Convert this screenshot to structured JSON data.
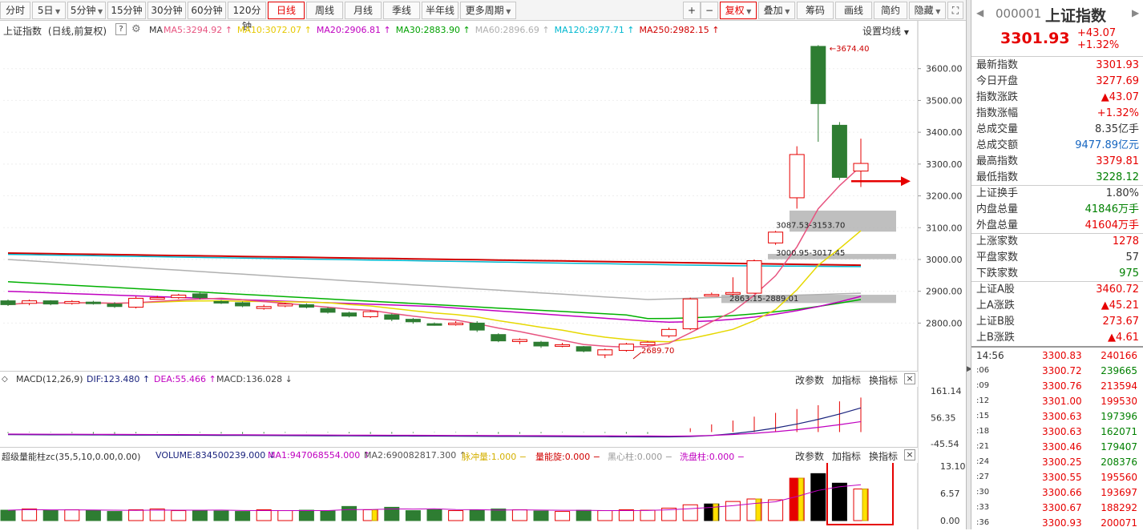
{
  "toolbar": {
    "periods": [
      {
        "label": "分时",
        "dd": false
      },
      {
        "label": "5日",
        "dd": true
      },
      {
        "label": "5分钟",
        "dd": true
      },
      {
        "label": "15分钟",
        "dd": false
      },
      {
        "label": "30分钟",
        "dd": false
      },
      {
        "label": "60分钟",
        "dd": false
      },
      {
        "label": "120分钟",
        "dd": false
      },
      {
        "label": "日线",
        "dd": false
      },
      {
        "label": "周线",
        "dd": false
      },
      {
        "label": "月线",
        "dd": false
      },
      {
        "label": "季线",
        "dd": false
      },
      {
        "label": "半年线",
        "dd": false
      },
      {
        "label": "更多周期",
        "dd": true
      }
    ],
    "active_period": "日线",
    "plus": "+",
    "minus": "−",
    "fuquan": "复权",
    "diejia": "叠加",
    "chouma": "筹码",
    "huaxian": "画线",
    "jianyue": "简约",
    "yincang": "隐藏"
  },
  "header": {
    "title": "上证指数",
    "mode": "(日线,前复权)",
    "help": "?",
    "ma_label": "MA",
    "ma": [
      {
        "name": "MA5",
        "value": "3294.92",
        "color": "#e75480"
      },
      {
        "name": "MA10",
        "value": "3072.07",
        "color": "#e6c800"
      },
      {
        "name": "MA20",
        "value": "2906.81",
        "color": "#c000c0"
      },
      {
        "name": "MA30",
        "value": "2883.90",
        "color": "#00a000"
      },
      {
        "name": "MA60",
        "value": "2896.69",
        "color": "#b0b0b0"
      },
      {
        "name": "MA120",
        "value": "2977.71",
        "color": "#00b8d0"
      },
      {
        "name": "MA250",
        "value": "2982.15",
        "color": "#d00000"
      }
    ],
    "settings": "设置均线"
  },
  "annotations": {
    "high": "3674.40",
    "low": "2689.70",
    "zone1": "3087.53-3153.70",
    "zone2": "3000.95-3017.45",
    "zone3": "2863.15-2889.01"
  },
  "macd": {
    "title": "MACD(12,26,9)",
    "dif_label": "DIF:",
    "dif": "123.480",
    "dea_label": "DEA:",
    "dea": "55.466",
    "macd_label": "MACD:",
    "macd": "136.028",
    "btn_params": "改参数",
    "btn_add": "加指标",
    "btn_switch": "换指标",
    "close": "×"
  },
  "vol": {
    "title": "超级量能柱zc(35,5,10,0.00,0.00)",
    "volume_label": "VOLUME:",
    "volume": "834500239.000",
    "ma1_label": "MA1:",
    "ma1": "947068554.000",
    "ma2_label": "MA2:",
    "ma2": "690082817.300",
    "mcl_label": "脉冲量:",
    "mcl": "1.000",
    "nlx_label": "量能旋:",
    "nlx": "0.000",
    "hxz_label": "黑心柱:",
    "hxz": "0.000",
    "xpz_label": "洗盘柱:",
    "xpz": "0.000",
    "btn_params": "改参数",
    "btn_add": "加指标",
    "btn_switch": "换指标",
    "close": "×"
  },
  "chart_data": [
    {
      "type": "candlestick",
      "title": "上证指数",
      "yticks": [
        "3600.00",
        "3500.00",
        "3400.00",
        "3300.00",
        "3200.00",
        "3100.00",
        "3000.00",
        "2900.00",
        "2800.00"
      ],
      "ylim": [
        2660,
        3700
      ],
      "candles": [
        {
          "o": 2870,
          "c": 2858,
          "h": 2874,
          "l": 2854
        },
        {
          "o": 2862,
          "c": 2870,
          "h": 2874,
          "l": 2856
        },
        {
          "o": 2870,
          "c": 2860,
          "h": 2872,
          "l": 2856
        },
        {
          "o": 2862,
          "c": 2868,
          "h": 2872,
          "l": 2858
        },
        {
          "o": 2866,
          "c": 2862,
          "h": 2870,
          "l": 2858
        },
        {
          "o": 2860,
          "c": 2852,
          "h": 2866,
          "l": 2848
        },
        {
          "o": 2850,
          "c": 2878,
          "h": 2884,
          "l": 2846
        },
        {
          "o": 2878,
          "c": 2880,
          "h": 2886,
          "l": 2874
        },
        {
          "o": 2880,
          "c": 2888,
          "h": 2892,
          "l": 2876
        },
        {
          "o": 2892,
          "c": 2880,
          "h": 2896,
          "l": 2874
        },
        {
          "o": 2868,
          "c": 2864,
          "h": 2872,
          "l": 2860
        },
        {
          "o": 2864,
          "c": 2854,
          "h": 2868,
          "l": 2850
        },
        {
          "o": 2846,
          "c": 2852,
          "h": 2858,
          "l": 2842
        },
        {
          "o": 2854,
          "c": 2860,
          "h": 2864,
          "l": 2850
        },
        {
          "o": 2858,
          "c": 2850,
          "h": 2862,
          "l": 2846
        },
        {
          "o": 2846,
          "c": 2834,
          "h": 2850,
          "l": 2830
        },
        {
          "o": 2832,
          "c": 2822,
          "h": 2836,
          "l": 2818
        },
        {
          "o": 2820,
          "c": 2836,
          "h": 2840,
          "l": 2816
        },
        {
          "o": 2826,
          "c": 2812,
          "h": 2830,
          "l": 2806
        },
        {
          "o": 2812,
          "c": 2804,
          "h": 2816,
          "l": 2798
        },
        {
          "o": 2798,
          "c": 2796,
          "h": 2802,
          "l": 2792
        },
        {
          "o": 2796,
          "c": 2800,
          "h": 2806,
          "l": 2792
        },
        {
          "o": 2800,
          "c": 2778,
          "h": 2806,
          "l": 2772
        },
        {
          "o": 2764,
          "c": 2744,
          "h": 2768,
          "l": 2740
        },
        {
          "o": 2742,
          "c": 2748,
          "h": 2752,
          "l": 2734
        },
        {
          "o": 2740,
          "c": 2728,
          "h": 2744,
          "l": 2722
        },
        {
          "o": 2730,
          "c": 2732,
          "h": 2738,
          "l": 2724
        },
        {
          "o": 2726,
          "c": 2712,
          "h": 2728,
          "l": 2708
        },
        {
          "o": 2700,
          "c": 2716,
          "h": 2720,
          "l": 2690
        },
        {
          "o": 2714,
          "c": 2734,
          "h": 2738,
          "l": 2710
        },
        {
          "o": 2732,
          "c": 2740,
          "h": 2744,
          "l": 2728
        },
        {
          "o": 2760,
          "c": 2780,
          "h": 2786,
          "l": 2754
        },
        {
          "o": 2782,
          "c": 2876,
          "h": 2880,
          "l": 2778
        },
        {
          "o": 2888,
          "c": 2890,
          "h": 2896,
          "l": 2884
        },
        {
          "o": 2892,
          "c": 2896,
          "h": 2944,
          "l": 2886
        },
        {
          "o": 2894,
          "c": 2996,
          "h": 3000,
          "l": 2892
        },
        {
          "o": 3052,
          "c": 3086,
          "h": 3090,
          "l": 3046
        },
        {
          "o": 3194,
          "c": 3330,
          "h": 3356,
          "l": 3160
        },
        {
          "o": 3670,
          "c": 3490,
          "h": 3674,
          "l": 3370
        },
        {
          "o": 3422,
          "c": 3258,
          "h": 3432,
          "l": 3250
        },
        {
          "o": 3278,
          "c": 3302,
          "h": 3380,
          "l": 3228
        }
      ],
      "ma_lines": [
        "MA5",
        "MA10",
        "MA20",
        "MA30",
        "MA60",
        "MA120",
        "MA250"
      ],
      "price_level_arrow": 3246
    },
    {
      "type": "line",
      "title": "MACD(12,26,9)",
      "yticks": [
        "161.14",
        "56.35",
        "-45.54"
      ],
      "series": [
        {
          "name": "DIF"
        },
        {
          "name": "DEA"
        },
        {
          "name": "MACD"
        }
      ]
    },
    {
      "type": "bar",
      "title": "超级量能柱zc(35,5,10,0.00,0.00)",
      "yticks": [
        "13.10",
        "6.57",
        "0.00"
      ],
      "series": [
        {
          "name": "VOLUME"
        },
        {
          "name": "MA1"
        },
        {
          "name": "MA2"
        }
      ]
    }
  ],
  "quote": {
    "arrow_left": "◀",
    "code": "000001",
    "name": "上证指数",
    "price": "3301.93",
    "change": "+43.07",
    "change_pct": "+1.32%",
    "arrow_right": "▶",
    "rows": [
      {
        "label": "最新指数",
        "value": "3301.93",
        "cls": "red"
      },
      {
        "label": "今日开盘",
        "value": "3277.69",
        "cls": "red"
      },
      {
        "label": "指数涨跌",
        "value": "▲43.07",
        "cls": "red"
      },
      {
        "label": "指数涨幅",
        "value": "+1.32%",
        "cls": "red"
      },
      {
        "label": "总成交量",
        "value": "8.35亿手",
        "cls": ""
      },
      {
        "label": "总成交额",
        "value": "9477.89亿元",
        "cls": "blue"
      },
      {
        "label": "最高指数",
        "value": "3379.81",
        "cls": "red"
      },
      {
        "label": "最低指数",
        "value": "3228.12",
        "cls": "green"
      },
      {
        "label": "上证换手",
        "value": "1.80%",
        "cls": ""
      },
      {
        "label": "内盘总量",
        "value": "41846万手",
        "cls": "green"
      },
      {
        "label": "外盘总量",
        "value": "41604万手",
        "cls": "red"
      },
      {
        "label": "上涨家数",
        "value": "1278",
        "cls": "red"
      },
      {
        "label": "平盘家数",
        "value": "57",
        "cls": ""
      },
      {
        "label": "下跌家数",
        "value": "975",
        "cls": "green"
      },
      {
        "label": "上证A股",
        "value": "3460.72",
        "cls": "red"
      },
      {
        "label": "上A涨跌",
        "value": "▲45.21",
        "cls": "red"
      },
      {
        "label": "上证B股",
        "value": "273.67",
        "cls": "red"
      },
      {
        "label": "上B涨跌",
        "value": "▲4.61",
        "cls": "red"
      }
    ],
    "ticks": [
      {
        "t": "14:56",
        "p": "3300.83",
        "v": "240166",
        "vc": "red"
      },
      {
        "t": ":06",
        "p": "3300.72",
        "v": "239665",
        "vc": "green"
      },
      {
        "t": ":09",
        "p": "3300.76",
        "v": "213594",
        "vc": "red"
      },
      {
        "t": ":12",
        "p": "3301.00",
        "v": "199530",
        "vc": "red"
      },
      {
        "t": ":15",
        "p": "3300.63",
        "v": "197396",
        "vc": "green"
      },
      {
        "t": ":18",
        "p": "3300.63",
        "v": "162071",
        "vc": "green"
      },
      {
        "t": ":21",
        "p": "3300.46",
        "v": "179407",
        "vc": "green"
      },
      {
        "t": ":24",
        "p": "3300.25",
        "v": "208376",
        "vc": "green"
      },
      {
        "t": ":27",
        "p": "3300.55",
        "v": "195560",
        "vc": "red"
      },
      {
        "t": ":30",
        "p": "3300.66",
        "v": "193697",
        "vc": "red"
      },
      {
        "t": ":33",
        "p": "3300.67",
        "v": "188292",
        "vc": "red"
      },
      {
        "t": ":36",
        "p": "3300.93",
        "v": "200071",
        "vc": "red"
      }
    ]
  }
}
